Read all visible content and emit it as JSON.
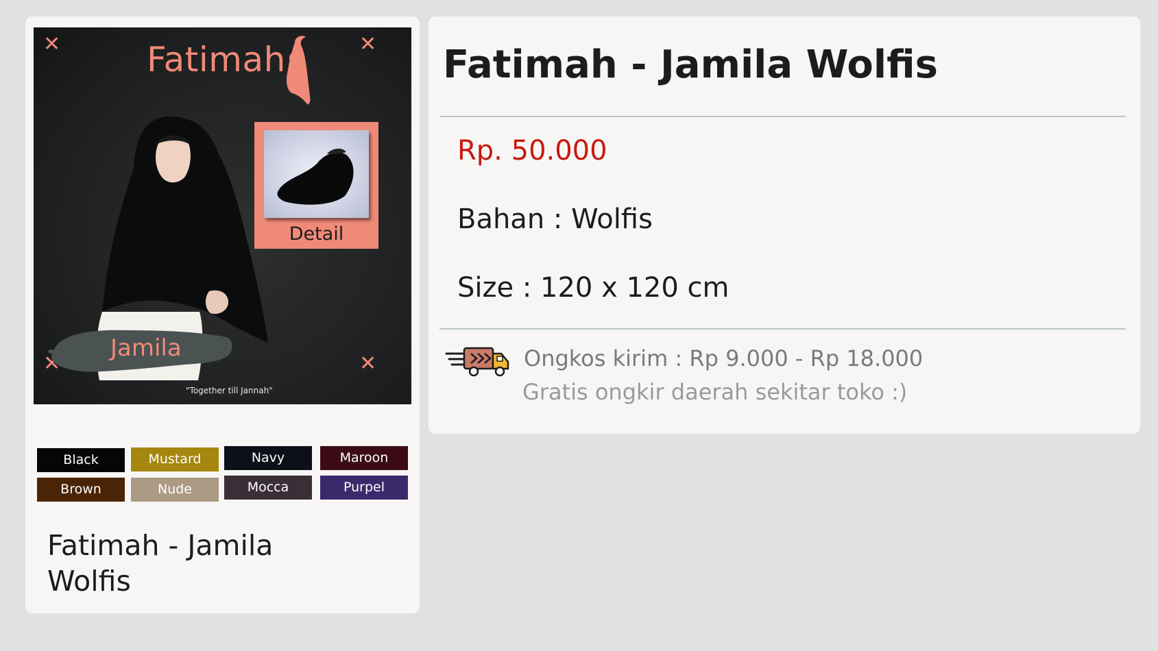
{
  "product_image": {
    "brand": "Fatimah",
    "detail_label": "Detail",
    "model_label": "Jamila",
    "tagline": "\"Together till Jannah\""
  },
  "colors": [
    {
      "label": "Black",
      "color": "#050607"
    },
    {
      "label": "Mustard",
      "color": "#a5860e"
    },
    {
      "label": "Navy",
      "color": "#0d1018"
    },
    {
      "label": "Maroon",
      "color": "#3b0c17"
    },
    {
      "label": "Brown",
      "color": "#4a2406"
    },
    {
      "label": "Nude",
      "color": "#ad9a85"
    },
    {
      "label": "Mocca",
      "color": "#3a2f37"
    },
    {
      "label": "Purpel",
      "color": "#3b2a6b"
    }
  ],
  "card": {
    "name": "Fatimah - Jamila Wolfis"
  },
  "detail": {
    "title": "Fatimah - Jamila Wolfis",
    "price": "Rp. 50.000",
    "material": "Bahan : Wolfis",
    "size": "Size : 120 x 120 cm",
    "shipping": "Ongkos kirim : Rp 9.000 - Rp 18.000",
    "shipping_note": "Gratis ongkir daerah sekitar toko :)"
  },
  "accent_color": "#f08a78",
  "price_color": "#c8190e"
}
